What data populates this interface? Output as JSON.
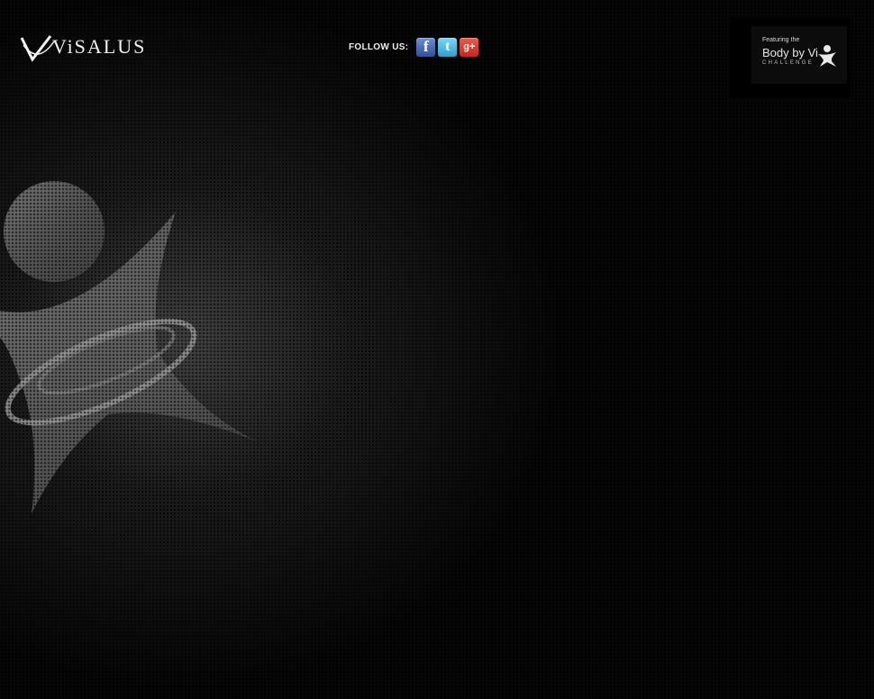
{
  "header": {
    "logo_text": "ViSALUS",
    "logo_trademark": "™",
    "follow_label": "FOLLOW US:",
    "social": [
      {
        "name": "facebook",
        "glyph": "f",
        "icon": "facebook-icon",
        "color": "#3b5998"
      },
      {
        "name": "twitter",
        "glyph": "t",
        "icon": "twitter-icon",
        "color": "#33b5e5"
      },
      {
        "name": "google-plus",
        "glyph": "g+",
        "icon": "google-plus-icon",
        "color": "#dd3b2c"
      }
    ]
  },
  "badge": {
    "featuring": "Featuring the",
    "title": "Body by Vi",
    "subtitle": "CHALLENGE",
    "icon": "body-by-vi-figure-icon"
  },
  "hero": {
    "icon": "visalus-figure-emblem"
  }
}
